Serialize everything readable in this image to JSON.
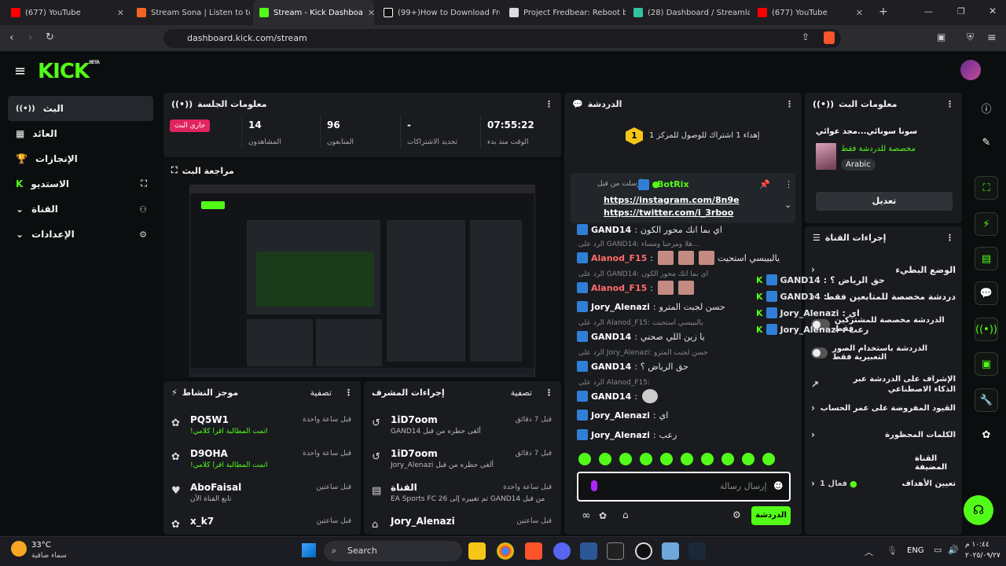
{
  "browser": {
    "tabs": [
      {
        "title": "(677) YouTube",
        "color": "#ff0000"
      },
      {
        "title": "Stream Sona | Listen to to m",
        "color": "#f26522"
      },
      {
        "title": "Stream - Kick Dashboa",
        "color": "#53fc18"
      },
      {
        "title": "(99+)How to Download Fre",
        "color": "#ffffff"
      },
      {
        "title": "Project Fredbear: Reboot by",
        "color": "#dddddd"
      },
      {
        "title": "(28) Dashboard / Streamlab",
        "color": "#31c3a2"
      },
      {
        "title": "(677) YouTube",
        "color": "#ff0000"
      }
    ],
    "url": "dashboard.kick.com/stream"
  },
  "sidebar": {
    "items": [
      {
        "label": "البث",
        "icon": "broadcast-icon"
      },
      {
        "label": "العائد",
        "icon": "chart-icon"
      },
      {
        "label": "الإنجازات",
        "icon": "trophy-icon"
      },
      {
        "label": "الاستديو",
        "icon": "studio-icon"
      },
      {
        "label": "القناة",
        "icon": "channel-icon"
      },
      {
        "label": "الإعدادات",
        "icon": "gear-icon"
      }
    ]
  },
  "session": {
    "title": "معلومات الجلسة",
    "live_badge": "جاري البث",
    "stats": [
      {
        "value": "14",
        "label": "المشاهدون"
      },
      {
        "value": "96",
        "label": "المتابعون"
      },
      {
        "value": "-",
        "label": "تحديد الاشتراكات"
      },
      {
        "value": "07:55:22",
        "label": "الوقت منذ بدء"
      }
    ]
  },
  "preview": {
    "title": "مراجعة البث"
  },
  "activity": {
    "title": "موجز النشاط",
    "filter": "تصفية",
    "items": [
      {
        "name": "PQ5W1",
        "sub": "!اتمت المطالبة اقرا كلامي",
        "time": "قبل ساعة واحدة"
      },
      {
        "name": "D9OHA",
        "sub": "!اتمت المطالبة اقرا كلامي",
        "time": "قبل ساعة واحدة"
      },
      {
        "name": "AboFaisal",
        "sub": "تابع القناة الآن",
        "time": "قبل ساعتين"
      },
      {
        "name": "x_k7",
        "sub": "",
        "time": "قبل ساعتين"
      }
    ]
  },
  "modactions": {
    "title": "إجراءات المشرف",
    "filter": "تصفية",
    "items": [
      {
        "name": "1iD7oom",
        "sub": "GAND14 ألغى حظره من قبل",
        "time": "قبل 7 دقائق"
      },
      {
        "name": "1iD7oom",
        "sub": "Jory_Alenazi ألغى حظره من قبل",
        "time": "قبل 7 دقائق"
      },
      {
        "name": "القناة",
        "sub": "EA Sports FC 26 تم تغييره إلى GAND14 من قبل",
        "time": "قبل ساعة واحدة"
      },
      {
        "name": "Jory_Alenazi",
        "sub": "",
        "time": "قبل ساعتين"
      }
    ]
  },
  "chat": {
    "title": "الدردشة",
    "goal": "إهداء 1 اشتراك للوصول للمركز 1",
    "pinned_user": "BotRix",
    "pinned_sent": "أرسلت من قبل",
    "pinned_line1": "https://instagram.com/8n9e",
    "pinned_line2": "https://twitter.com/i_3rboo",
    "messages": [
      {
        "user": "GAND14",
        "text": "اي بما انك محور الكون",
        "reply": ""
      },
      {
        "user": "Alanod_F15",
        "text": "يالبيبسي استحيت",
        "reply": "الرد على GAND14: هلا ومرحبا ومساء..."
      },
      {
        "user": "Alanod_F15",
        "text": "",
        "reply": "الرد على GAND14: اي بما انك محور الكون"
      },
      {
        "user": "Jory_Alenazi",
        "text": "حسن لجبت المترو",
        "reply": ""
      },
      {
        "user": "GAND14",
        "text": "يا زين اللي صحني",
        "reply": "الرد على Alanod_F15: يالبيبسي استحيت"
      },
      {
        "user": "GAND14",
        "text": "حق الرياض ؟",
        "reply": "الرد على Jory_Alenazi: حسن لجبت المترو"
      },
      {
        "user": "GAND14",
        "text": "",
        "reply": "الرد على Alanod_F15:"
      },
      {
        "user": "Jory_Alenazi",
        "text": "اي",
        "reply": ""
      },
      {
        "user": "Jory_Alenazi",
        "text": "رعب",
        "reply": ""
      }
    ],
    "input_placeholder": "إرسال رسالة",
    "send_label": "الدردشة"
  },
  "streaminfo": {
    "title": "معلومات البث",
    "stream_title": "سونا سونائي...مجد عوائي",
    "subtitle": "مخصصة للدردشة فقط",
    "language": "Arabic",
    "edit": "تعديل"
  },
  "channelactions": {
    "title": "إجراءات القناة",
    "rows": [
      {
        "label": "الوضع البطيء",
        "type": "chevron"
      },
      {
        "label": "دردشة مخصصة للمتابعين فقط",
        "type": "chevron"
      },
      {
        "label": "الدردشة مخصصة للمشتركين فقط",
        "type": "toggle"
      },
      {
        "label": "الدردشة باستخدام الصور التعبيرية فقط",
        "type": "toggle"
      },
      {
        "label": "الإشراف على الدردشة عبر الذكاء الاصطناعي",
        "type": "link"
      },
      {
        "label": "القيود المفروضة على عمر الحساب",
        "type": "chevron"
      },
      {
        "label": "الكلمات المحظورة",
        "type": "chevron"
      }
    ],
    "channel_points": "القناة المضيفة",
    "set_goals": "تعيين الأهداف",
    "goal_status": "فعال 1"
  },
  "overlay_chat": [
    {
      "user": "GAND14",
      "text": "حق الرياض ؟"
    },
    {
      "user": "GAND14",
      "text": ""
    },
    {
      "user": "Jory_Alenazi",
      "text": "اي"
    },
    {
      "user": "Jory_Alenazi",
      "text": "رعب"
    }
  ],
  "taskbar": {
    "weather_temp": "33°C",
    "weather_desc": "سماء صافية",
    "search": "Search",
    "lang": "ENG",
    "time": "١٠:٤٤ م",
    "date": "٢٠٢٥/٠٩/٢٧"
  },
  "colors": {
    "accent": "#53fc18",
    "live": "#e0245e"
  }
}
